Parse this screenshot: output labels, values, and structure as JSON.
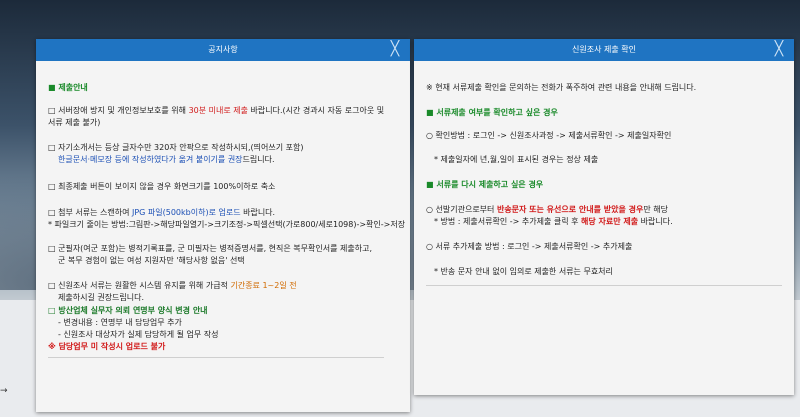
{
  "notice": {
    "title": "공지사항",
    "close": "╳",
    "heading": "■ 제출안내",
    "item1_a": "□ 서버장애 방지 및 개인정보보호를 위해 ",
    "item1_b": "30분 미내로 제출",
    "item1_c": " 바랍니다.(시간 경과시 자동 로그아웃 및",
    "item1_d": "서류 제출 불가)",
    "item2_a": "□ 자기소개서는 등상 글자수만 320자 안팍으로 작성하시되,(띄어쓰기 포함)",
    "item2_b": "한글문서·메모장 등에 작성하였다가 옮겨 붙이기를 권장",
    "item2_c": "드립니다.",
    "item3": "□ 최종제출 버튼이 보이지 않을 경우 화면크기를 100%이하로 축소",
    "item4_a": "□ 첨부 서류는 스캔하여 ",
    "item4_b": "JPG 파일(500kb이하)로 업로드",
    "item4_c": " 바랍니다.",
    "item4_d": "* 파일크기 줄이는 방법:그림판->해당파일열기->크기조정->픽셀선택(가로800/세로1098)->확인->저장",
    "item5_a": "□ 군필자(여군 포함)는 병적기록표를, 군 미필자는 병적증명서를, 현직은 복무확인서를 제출하고,",
    "item5_b": "군 복무 경험이 없는 여성 지원자만 '해당사항 없음' 선택",
    "item6_a": "□ 신원조사 서류는 원활한 시스템 유지를 위해 가급적 ",
    "item6_b": "기간종료 1~2일 전",
    "item6_c": "제출하시길 권장드립니다.",
    "item7_a": "□ 방산업체 실무자 의뢰 연명부 양식 변경 안내",
    "item7_b": "- 변경내용 : 연명부 내 담당업무 추가",
    "item7_c": "- 신원조사 대상자가 실제 담당하게 될 업무 작성",
    "item7_d": "※ 담당업무 미 작성시 업로드 불가"
  },
  "cert": {
    "title": "신원조사 제출 확인",
    "close": "╳",
    "intro": "※ 현재 서류제출 확인을 문의하는 전화가 폭주하여 관련 내용을 안내해 드립니다.",
    "sec1": "■ 서류제출 여부를 확인하고 싶은 경우",
    "sec1_path": "○ 확인방법 : 로그인 -> 신원조사과정 -> 제출서류확인 -> 제출일자확인",
    "sec1_note": "* 제출일자에 년,월,일이 표시된 경우는 정상 제출",
    "sec2": "■ 서류를 다시 제출하고 싶은 경우",
    "sec2_a1": "○ 선발기관으로부터 ",
    "sec2_a2": "반송문자 또는 유선으로 안내를 받았을 경우",
    "sec2_a3": "만 해당",
    "sec2_b1": "* 방법 : 제출서류확인 -> 추가제출 클릭 후 ",
    "sec2_b2": "해당 자료만 제출",
    "sec2_b3": " 바랍니다.",
    "sec2_c": "○ 서류 추가제출 방법 : 로그인 -> 제출서류확인 -> 추가제출",
    "sec2_d": "* 반송 문자 안내 없이 임의로 제출한 서류는 무효처리"
  },
  "page": {
    "back_arrow": "→"
  },
  "colors": {
    "titlebar": "#1f74c2",
    "heading_green": "#1a8a2a",
    "link_blue": "#1b4fb5",
    "warning_red": "#d11a1a"
  }
}
